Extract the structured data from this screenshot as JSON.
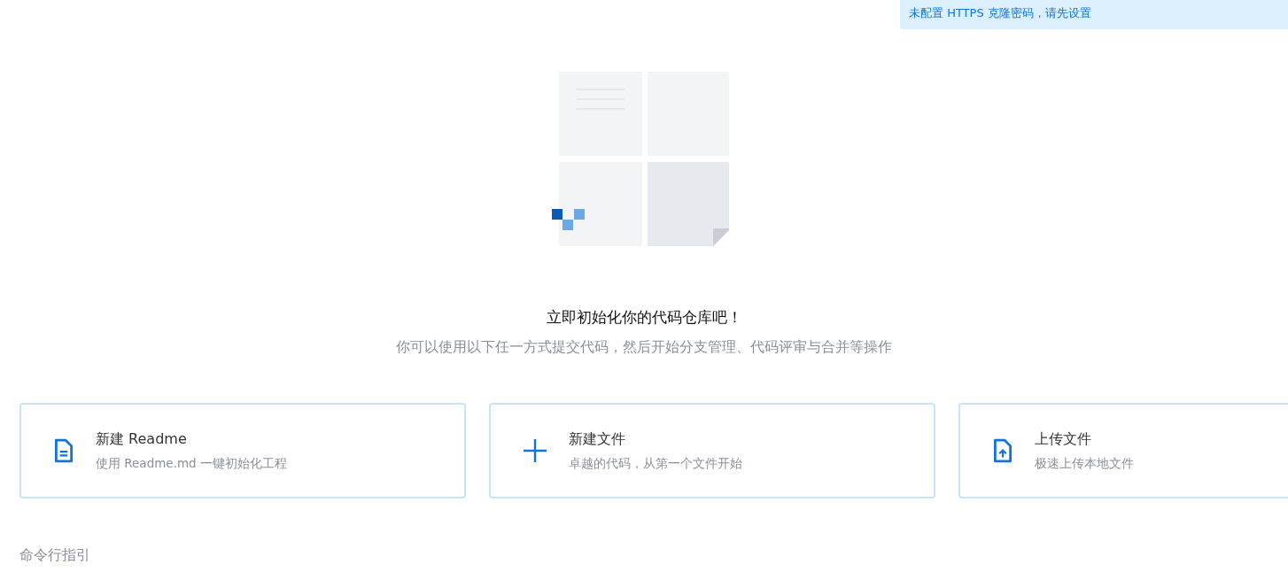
{
  "notice": {
    "text": "未配置 HTTPS 克隆密码，请先设置"
  },
  "empty_state": {
    "title": "立即初始化你的代码仓库吧！",
    "subtitle": "你可以使用以下任一方式提交代码，然后开始分支管理、代码评审与合并等操作"
  },
  "cards": [
    {
      "kind": "readme",
      "title": "新建 Readme",
      "description": "使用 Readme.md 一键初始化工程"
    },
    {
      "kind": "file",
      "title": "新建文件",
      "description": "卓越的代码，从第一个文件开始"
    },
    {
      "kind": "upload",
      "title": "上传文件",
      "description": "极速上传本地文件"
    }
  ],
  "section_title": "命令行指引"
}
